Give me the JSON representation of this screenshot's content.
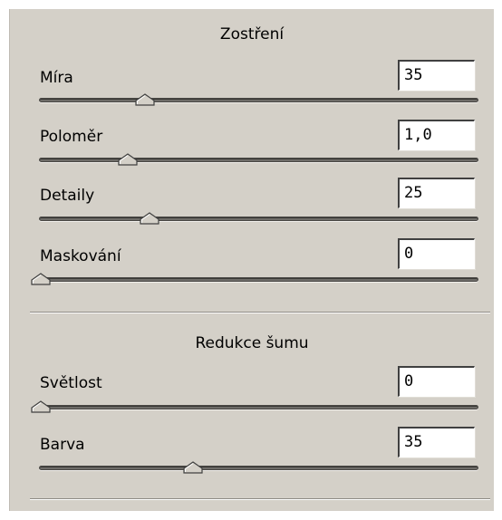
{
  "sharpening": {
    "title": "Zostření",
    "sliders": [
      {
        "label": "Míra",
        "value": "35",
        "level": 0.24
      },
      {
        "label": "Poloměr",
        "value": "1,0",
        "level": 0.2
      },
      {
        "label": "Detaily",
        "value": "25",
        "level": 0.25
      },
      {
        "label": "Maskování",
        "value": "0",
        "level": 0.0
      }
    ]
  },
  "noise_reduction": {
    "title": "Redukce šumu",
    "sliders": [
      {
        "label": "Světlost",
        "value": "0",
        "level": 0.0
      },
      {
        "label": "Barva",
        "value": "35",
        "level": 0.35
      }
    ]
  }
}
